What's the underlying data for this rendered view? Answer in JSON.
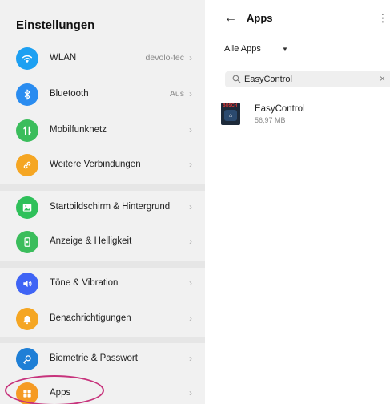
{
  "settings": {
    "title": "Einstellungen",
    "items": [
      {
        "label": "WLAN",
        "value": "devolo-fec",
        "icon": "wifi-icon",
        "color": "#1da0f2"
      },
      {
        "label": "Bluetooth",
        "value": "Aus",
        "icon": "bluetooth-icon",
        "color": "#2a8cf0"
      },
      {
        "label": "Mobilfunknetz",
        "value": "",
        "icon": "mobile-network-icon",
        "color": "#3bbd5c"
      },
      {
        "label": "Weitere Verbindungen",
        "value": "",
        "icon": "link-icon",
        "color": "#f5a623"
      },
      {
        "label": "Startbildschirm & Hintergrund",
        "value": "",
        "icon": "image-icon",
        "color": "#2fc05a"
      },
      {
        "label": "Anzeige & Helligkeit",
        "value": "",
        "icon": "display-icon",
        "color": "#3bbd5c"
      },
      {
        "label": "Töne & Vibration",
        "value": "",
        "icon": "speaker-icon",
        "color": "#3f64f5"
      },
      {
        "label": "Benachrichtigungen",
        "value": "",
        "icon": "bell-icon",
        "color": "#f5a623"
      },
      {
        "label": "Biometrie & Passwort",
        "value": "",
        "icon": "key-icon",
        "color": "#1f7fd6"
      },
      {
        "label": "Apps",
        "value": "",
        "icon": "apps-icon",
        "color": "#f59a23"
      }
    ]
  },
  "apps_panel": {
    "title": "Apps",
    "filter_label": "Alle Apps",
    "search": {
      "value": "EasyControl"
    },
    "app": {
      "name": "EasyControl",
      "size": "56,97 MB",
      "brand": "BOSCH"
    }
  },
  "highlight_color": "#c7337c"
}
